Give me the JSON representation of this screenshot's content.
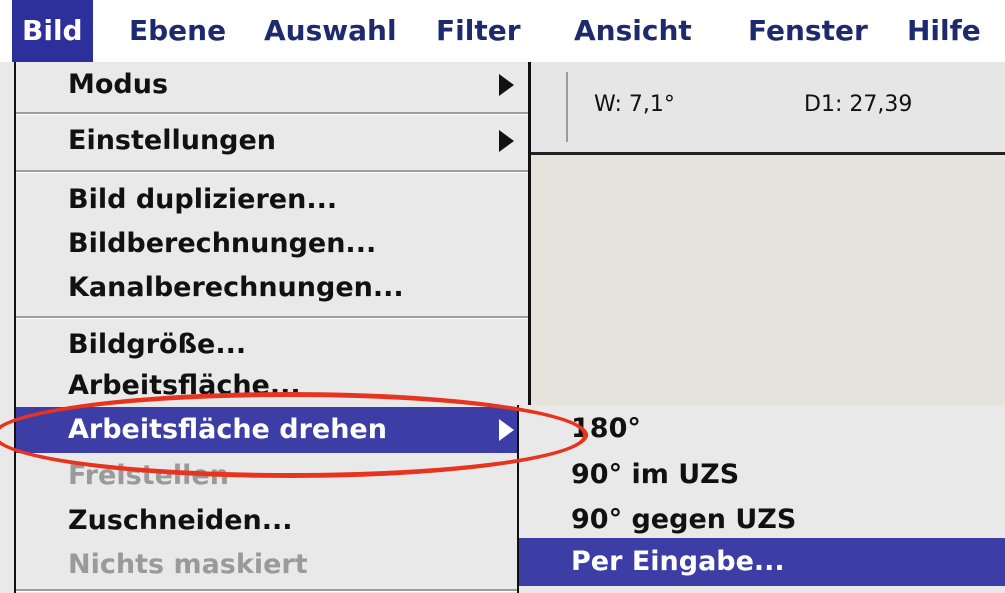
{
  "menubar": {
    "items": [
      "Bild",
      "Ebene",
      "Auswahl",
      "Filter",
      "Ansicht",
      "Fenster",
      "Hilfe"
    ],
    "active_index": 0
  },
  "toolbar": {
    "angle": "W:  7,1°",
    "distance": "D1:  27,39"
  },
  "bild_menu": {
    "items": [
      {
        "label": "Modus",
        "submenu": true
      },
      {
        "label": "Einstellungen",
        "submenu": true
      },
      {
        "label": "Bild duplizieren..."
      },
      {
        "label": "Bildberechnungen..."
      },
      {
        "label": "Kanalberechnungen..."
      },
      {
        "label": "Bildgröße..."
      },
      {
        "label": "Arbeitsfläche..."
      },
      {
        "label": "Arbeitsfläche drehen",
        "submenu": true,
        "highlighted": true
      },
      {
        "label": "Freistellen",
        "disabled": true
      },
      {
        "label": "Zuschneiden..."
      },
      {
        "label": "Nichts maskiert",
        "disabled": true
      }
    ]
  },
  "rotate_submenu": {
    "items": [
      {
        "label": "180°"
      },
      {
        "label": "90° im UZS"
      },
      {
        "label": "90° gegen UZS"
      },
      {
        "label": "Per Eingabe...",
        "highlighted": true
      }
    ]
  },
  "colors": {
    "menu_highlight": "#3c3ea6",
    "annotation": "#e8331f",
    "menu_bg": "#e9e9e9"
  }
}
